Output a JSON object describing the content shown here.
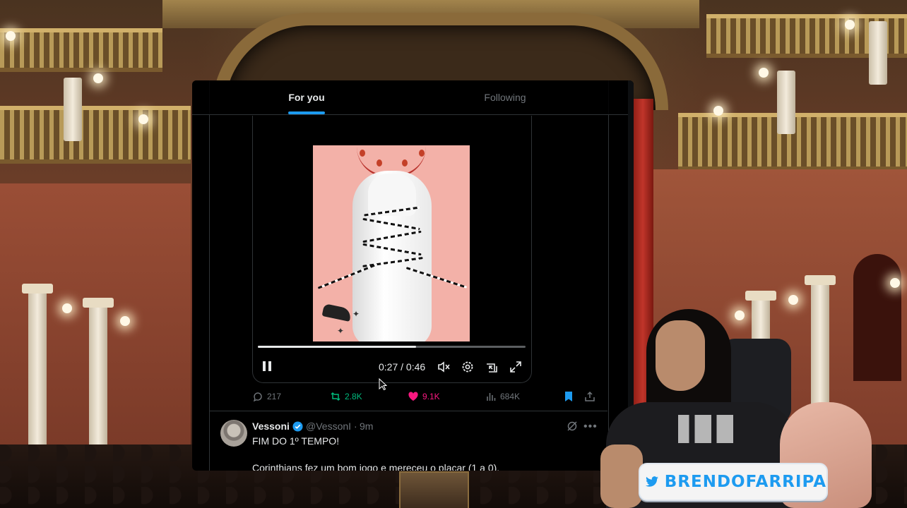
{
  "tabs": {
    "for_you": "For you",
    "following": "Following"
  },
  "video": {
    "time": "0:27 / 0:46",
    "progress": 0.59
  },
  "actions": {
    "replies": "217",
    "reposts": "2.8K",
    "likes": "9.1K",
    "views": "684K"
  },
  "next_tweet": {
    "name": "Vessoni",
    "handle": "@VessonI",
    "separator": "·",
    "time": "9m",
    "line1": "FIM DO 1º TEMPO!",
    "line2": "Corinthians fez um bom jogo e mereceu o placar (1 a 0)."
  },
  "stream_badge": {
    "text": "BRENDOFARRIPA"
  },
  "colors": {
    "accent": "#1d9bf0",
    "repost": "#00ba7c",
    "like": "#f91880",
    "muted": "#71767b"
  }
}
